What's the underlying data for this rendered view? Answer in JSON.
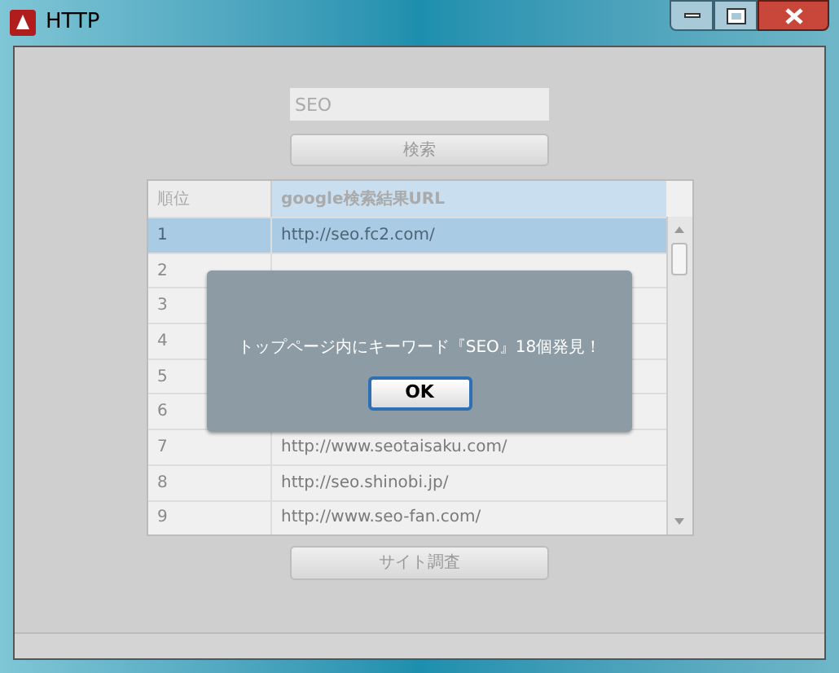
{
  "window": {
    "title": "HTTP"
  },
  "search": {
    "value": "SEO"
  },
  "search_button": "検索",
  "table": {
    "columns": [
      "順位",
      "google検索結果URL"
    ],
    "rows": [
      {
        "rank": "1",
        "url": "http://seo.fc2.com/",
        "selected": true
      },
      {
        "rank": "2",
        "selected": false
      },
      {
        "rank": "3",
        "selected": false
      },
      {
        "rank": "4",
        "selected": false
      },
      {
        "rank": "5",
        "selected": false
      },
      {
        "rank": "6",
        "selected": false
      },
      {
        "rank": "7",
        "url": "http://www.seotaisaku.com/",
        "selected": false
      },
      {
        "rank": "8",
        "url": "http://seo.shinobi.jp/",
        "selected": false
      },
      {
        "rank": "9",
        "url": "http://www.seo-fan.com/",
        "selected": false
      }
    ]
  },
  "site_button": "サイト調査",
  "dialog": {
    "message": "トップページ内にキーワード『SEO』18個発見！",
    "button": "OK"
  }
}
